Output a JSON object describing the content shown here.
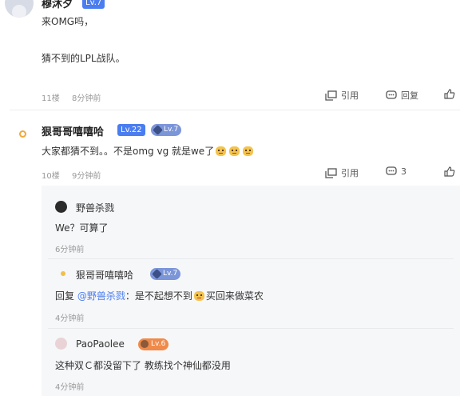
{
  "floor1": {
    "username": "穆沐夕",
    "level": "Lv.7",
    "line1": "来OMG吗，",
    "line2": "猜不到的LPL战队。",
    "floor_no": "11楼",
    "time": "8分钟前",
    "quote_label": "引用",
    "reply_label": "回复"
  },
  "floor2": {
    "username": "狠哥哥嘻嘻哈",
    "level": "Lv.22",
    "badge_level": "Lv.7",
    "content": "大家都猜不到。。不是omg vg 就是we了",
    "floor_no": "10楼",
    "time": "9分钟前",
    "quote_label": "引用",
    "reply_count": "3"
  },
  "replies": [
    {
      "username": "野兽杀戮",
      "content": "We？可算了",
      "time": "6分钟前"
    },
    {
      "username": "狠哥哥嘻嘻哈",
      "badge_level": "Lv.7",
      "prefix": "回复",
      "mention": "@野兽杀戮",
      "content_a": "：是不起想不到",
      "content_b": "买回来做菜农",
      "time": "4分钟前"
    },
    {
      "username": "PaoPaolee",
      "badge_level": "Lv.6",
      "content": "这种双Ｃ都没留下了 教练找个神仙都没用",
      "time": "4分钟前"
    }
  ],
  "colors": {
    "level_blue": "#4a7df0",
    "meta_gray": "#999999",
    "reply_bg": "#f6f7f9"
  }
}
